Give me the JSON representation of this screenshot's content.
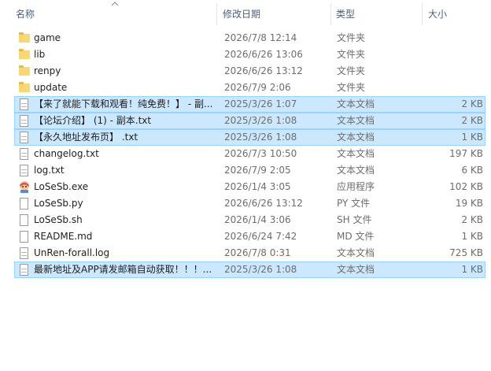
{
  "columns": {
    "name": "名称",
    "date": "修改日期",
    "type": "类型",
    "size": "大小"
  },
  "files": [
    {
      "name": "game",
      "date": "2026/7/8 12:14",
      "type": "文件夹",
      "size": "",
      "icon": "folder-icon",
      "selected": false
    },
    {
      "name": "lib",
      "date": "2026/6/26 13:06",
      "type": "文件夹",
      "size": "",
      "icon": "folder-icon",
      "selected": false
    },
    {
      "name": "renpy",
      "date": "2026/6/26 13:12",
      "type": "文件夹",
      "size": "",
      "icon": "folder-icon",
      "selected": false
    },
    {
      "name": "update",
      "date": "2026/7/9 2:06",
      "type": "文件夹",
      "size": "",
      "icon": "folder-icon",
      "selected": false
    },
    {
      "name": "【来了就能下载和观看！纯免费！】 - 副...",
      "date": "2025/3/26 1:07",
      "type": "文本文档",
      "size": "2 KB",
      "icon": "text-file-icon",
      "selected": true
    },
    {
      "name": "【论坛介绍】 (1) - 副本.txt",
      "date": "2025/3/26 1:08",
      "type": "文本文档",
      "size": "2 KB",
      "icon": "text-file-icon",
      "selected": true
    },
    {
      "name": "【永久地址发布页】 .txt",
      "date": "2025/3/26 1:08",
      "type": "文本文档",
      "size": "1 KB",
      "icon": "text-file-icon",
      "selected": true
    },
    {
      "name": "changelog.txt",
      "date": "2026/7/3 10:50",
      "type": "文本文档",
      "size": "197 KB",
      "icon": "text-file-icon",
      "selected": false
    },
    {
      "name": "log.txt",
      "date": "2026/7/9 2:05",
      "type": "文本文档",
      "size": "6 KB",
      "icon": "text-file-icon",
      "selected": false
    },
    {
      "name": "LoSeSb.exe",
      "date": "2026/1/4 3:05",
      "type": "应用程序",
      "size": "102 KB",
      "icon": "app-icon",
      "selected": false
    },
    {
      "name": "LoSeSb.py",
      "date": "2026/6/26 13:12",
      "type": "PY 文件",
      "size": "19 KB",
      "icon": "blank-file-icon",
      "selected": false
    },
    {
      "name": "LoSeSb.sh",
      "date": "2026/1/4 3:06",
      "type": "SH 文件",
      "size": "2 KB",
      "icon": "blank-file-icon",
      "selected": false
    },
    {
      "name": "README.md",
      "date": "2026/6/24 7:42",
      "type": "MD 文件",
      "size": "1 KB",
      "icon": "blank-file-icon",
      "selected": false
    },
    {
      "name": "UnRen-forall.log",
      "date": "2026/7/8 0:31",
      "type": "文本文档",
      "size": "725 KB",
      "icon": "text-file-icon",
      "selected": false
    },
    {
      "name": "最新地址及APP请发邮箱自动获取！！！...",
      "date": "2025/3/26 1:08",
      "type": "文本文档",
      "size": "1 KB",
      "icon": "text-file-icon",
      "selected": true
    }
  ],
  "colors": {
    "selection_bg": "#cce8ff",
    "selection_border": "#99d1ff",
    "folder": "#f8d775",
    "header_text": "#4c607a"
  }
}
